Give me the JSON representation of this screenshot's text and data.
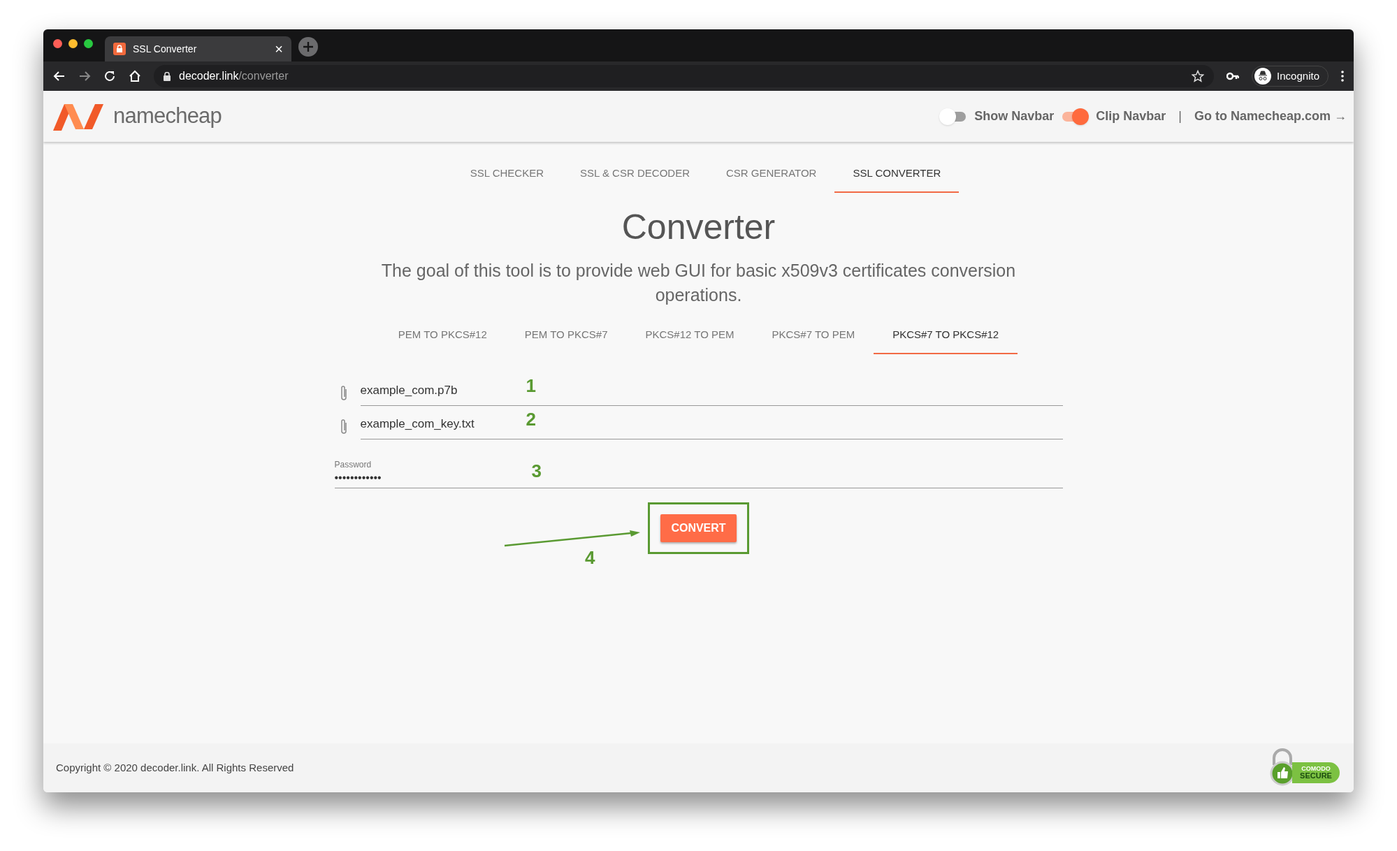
{
  "browser": {
    "tab": {
      "title": "SSL Converter",
      "close": "×"
    },
    "address": {
      "domain": "decoder.link",
      "path": "/converter"
    },
    "profile": "Incognito"
  },
  "header": {
    "brand": "namecheap",
    "toggles": [
      {
        "label": "Show Navbar",
        "on": false
      },
      {
        "label": "Clip Navbar",
        "on": true
      }
    ],
    "separator": "|",
    "link": "Go to Namecheap.com →"
  },
  "nav": [
    {
      "label": "SSL CHECKER",
      "selected": false
    },
    {
      "label": "SSL & CSR DECODER",
      "selected": false
    },
    {
      "label": "CSR GENERATOR",
      "selected": false
    },
    {
      "label": "SSL CONVERTER",
      "selected": true
    }
  ],
  "title": "Converter",
  "description": "The goal of this tool is to provide web GUI for basic x509v3 certificates conversion operations.",
  "modes": [
    {
      "label": "PEM TO PKCS#12",
      "selected": false
    },
    {
      "label": "PEM TO PKCS#7",
      "selected": false
    },
    {
      "label": "PKCS#12 TO PEM",
      "selected": false
    },
    {
      "label": "PKCS#7 TO PEM",
      "selected": false
    },
    {
      "label": "PKCS#7 TO PKCS#12",
      "selected": true
    }
  ],
  "fields": [
    {
      "kind": "file",
      "value": "example_com.p7b",
      "marker": "1"
    },
    {
      "kind": "file",
      "value": "example_com_key.txt",
      "marker": "2"
    },
    {
      "kind": "password",
      "label": "Password",
      "value": "••••••••••••",
      "marker": "3"
    }
  ],
  "convert": {
    "label": "CONVERT",
    "marker": "4"
  },
  "footer": {
    "copyright": "Copyright © 2020 decoder.link. All Rights Reserved",
    "seal": {
      "top": "COMODO",
      "bottom": "SECURE"
    }
  }
}
